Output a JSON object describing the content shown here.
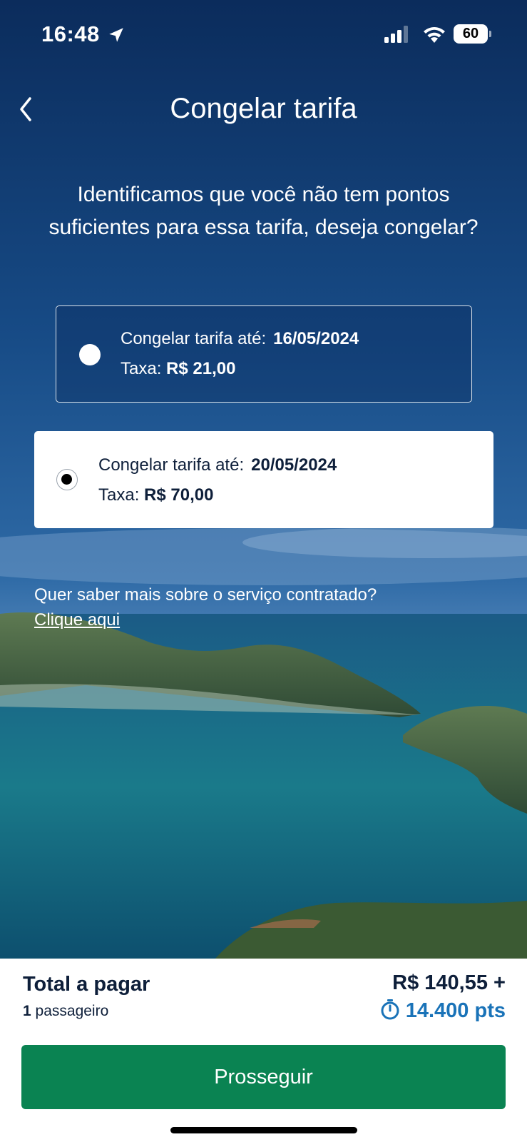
{
  "status_bar": {
    "time": "16:48",
    "battery": "60",
    "icons": [
      "location-arrow-icon",
      "cellular-signal-icon",
      "wifi-icon",
      "battery-icon"
    ]
  },
  "header": {
    "title": "Congelar tarifa",
    "back_icon": "chevron-left-icon"
  },
  "message": "Identificamos que você não tem pontos suficientes para essa tarifa, deseja congelar?",
  "options": [
    {
      "label": "Congelar tarifa até:",
      "date": "16/05/2024",
      "fee_label": "Taxa:",
      "fee": "R$ 21,00",
      "selected": false
    },
    {
      "label": "Congelar tarifa até:",
      "date": "20/05/2024",
      "fee_label": "Taxa:",
      "fee": "R$ 70,00",
      "selected": true
    }
  ],
  "more_info": {
    "question": "Quer saber mais sobre o serviço contratado?",
    "link": "Clique aqui"
  },
  "footer": {
    "total_label": "Total a pagar",
    "passenger_count": "1",
    "passenger_label": "passageiro",
    "price": "R$ 140,55 +",
    "points": "14.400 pts",
    "points_icon": "stopwatch-icon",
    "proceed_label": "Prosseguir"
  },
  "colors": {
    "primary_button": "#0a8352",
    "points": "#1a73b8",
    "text_dark": "#0e1f3a"
  }
}
